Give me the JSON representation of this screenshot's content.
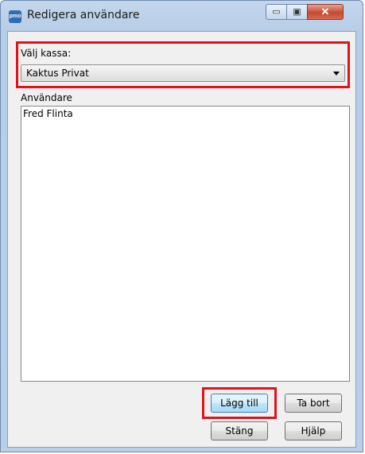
{
  "window": {
    "title": "Redigera användare",
    "app_icon_text": "pmo",
    "minimize_symbol": "▭",
    "maximize_symbol": "▣",
    "close_symbol": "✕"
  },
  "kassa": {
    "label": "Välj kassa:",
    "selected": "Kaktus Privat"
  },
  "users": {
    "label": "Användare",
    "items": [
      "Fred Flinta"
    ]
  },
  "buttons": {
    "add": "Lägg till",
    "remove": "Ta bort",
    "close": "Stäng",
    "help": "Hjälp"
  },
  "colors": {
    "highlight": "#e0131c",
    "titlebar": "#b9cfe8"
  }
}
